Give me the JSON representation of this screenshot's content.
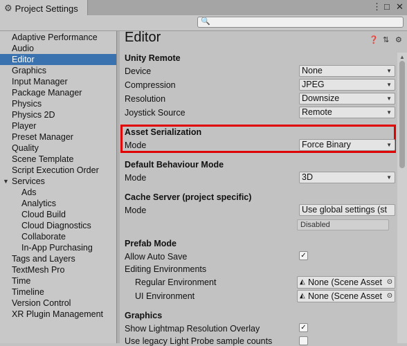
{
  "window": {
    "tab_title": "Project Settings",
    "tab_icon": "gear-icon",
    "menu_glyph": "⋮",
    "maximize_glyph": "□",
    "close_glyph": "✕"
  },
  "search": {
    "placeholder": "",
    "icon": "search-icon",
    "glyph": "🔍"
  },
  "sidebar": {
    "items": [
      {
        "label": "Adaptive Performance"
      },
      {
        "label": "Audio"
      },
      {
        "label": "Editor",
        "selected": true
      },
      {
        "label": "Graphics"
      },
      {
        "label": "Input Manager"
      },
      {
        "label": "Package Manager"
      },
      {
        "label": "Physics"
      },
      {
        "label": "Physics 2D"
      },
      {
        "label": "Player"
      },
      {
        "label": "Preset Manager"
      },
      {
        "label": "Quality"
      },
      {
        "label": "Scene Template"
      },
      {
        "label": "Script Execution Order"
      },
      {
        "label": "Services",
        "expanded": true
      },
      {
        "label": "Ads"
      },
      {
        "label": "Analytics"
      },
      {
        "label": "Cloud Build"
      },
      {
        "label": "Cloud Diagnostics"
      },
      {
        "label": "Collaborate"
      },
      {
        "label": "In-App Purchasing"
      },
      {
        "label": "Tags and Layers"
      },
      {
        "label": "TextMesh Pro"
      },
      {
        "label": "Time"
      },
      {
        "label": "Timeline"
      },
      {
        "label": "Version Control"
      },
      {
        "label": "XR Plugin Management"
      }
    ],
    "expand_glyph": "▼"
  },
  "main": {
    "title": "Editor",
    "header_icons": [
      "help-icon",
      "presets-icon",
      "settings-icon"
    ],
    "header_glyphs": [
      "❓",
      "⇅",
      "⚙"
    ],
    "unity_remote": {
      "heading": "Unity Remote",
      "device_label": "Device",
      "device_value": "None",
      "compression_label": "Compression",
      "compression_value": "JPEG",
      "resolution_label": "Resolution",
      "resolution_value": "Downsize",
      "joystick_label": "Joystick Source",
      "joystick_value": "Remote"
    },
    "asset_serialization": {
      "heading": "Asset Serialization",
      "mode_label": "Mode",
      "mode_value": "Force Binary"
    },
    "default_behaviour": {
      "heading": "Default Behaviour Mode",
      "mode_label": "Mode",
      "mode_value": "3D"
    },
    "cache_server": {
      "heading": "Cache Server (project specific)",
      "mode_label": "Mode",
      "mode_value": "Use global settings (st",
      "status": "Disabled"
    },
    "prefab_mode": {
      "heading": "Prefab Mode",
      "allow_auto_save_label": "Allow Auto Save",
      "allow_auto_save": true,
      "editing_env_label": "Editing Environments",
      "regular_env_label": "Regular Environment",
      "regular_env_value": "None (Scene Asset",
      "ui_env_label": "UI Environment",
      "ui_env_value": "None (Scene Asset"
    },
    "graphics": {
      "heading": "Graphics",
      "lightmap_overlay_label": "Show Lightmap Resolution Overlay",
      "lightmap_overlay": true,
      "legacy_probe_label": "Use legacy Light Probe sample counts",
      "legacy_probe": false
    },
    "dropdown_glyph": "▼",
    "check_glyph": "✓",
    "object_icon_glyph": "◭",
    "object_target_glyph": "⊙"
  }
}
